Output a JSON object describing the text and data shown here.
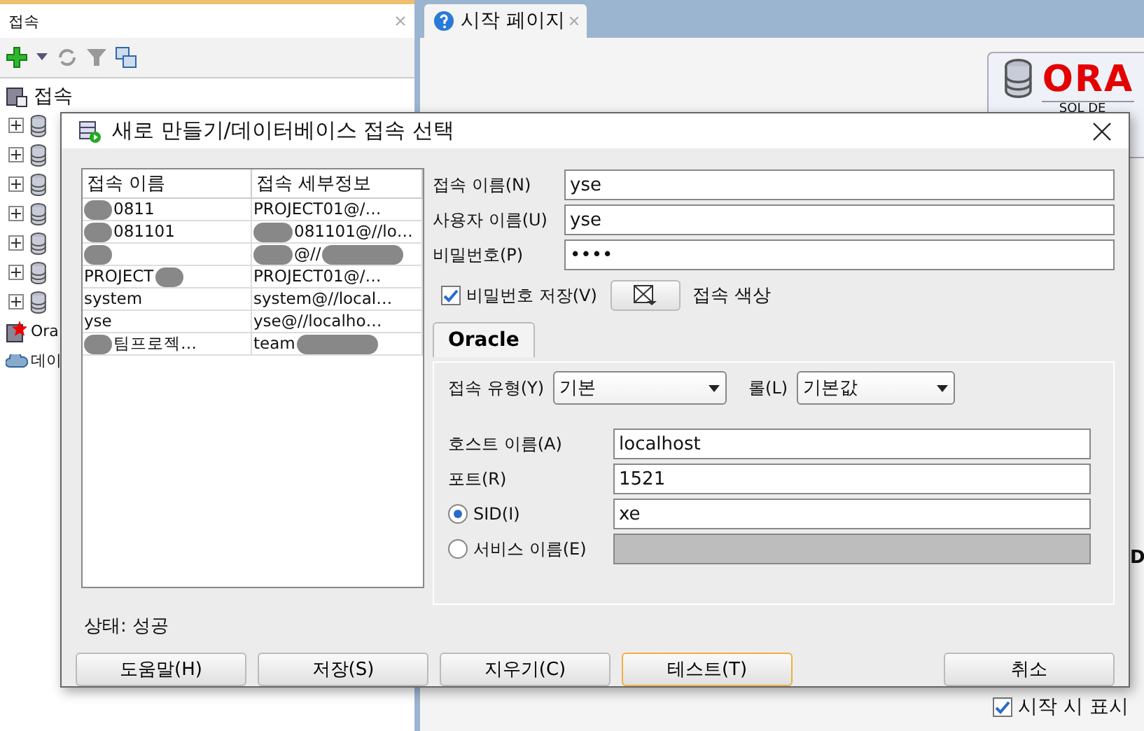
{
  "side_panel": {
    "title": "접속",
    "tree_root": "접속",
    "tree_items": [
      {
        "expanded": false
      },
      {
        "expanded": false
      },
      {
        "expanded": false
      },
      {
        "expanded": false
      },
      {
        "expanded": false
      },
      {
        "expanded": false
      },
      {
        "expanded": false
      }
    ],
    "extra_items": [
      {
        "label": "Ora",
        "kind": "oracle"
      },
      {
        "label": "데이",
        "kind": "cloud"
      }
    ]
  },
  "editor_tab": {
    "label": "시작 페이지"
  },
  "start_page": {
    "logo_text": "ORA",
    "logo_subtitle": "SQL DE",
    "cut_letter": "D",
    "show_on_start": {
      "label": "시작 시 표시",
      "checked": true
    }
  },
  "dialog": {
    "title": "새로 만들기/데이터베이스 접속 선택",
    "columns": [
      "접속 이름",
      "접속 세부정보"
    ],
    "rows": [
      {
        "name": {
          "text": "0811",
          "mask_before": true,
          "mask_after": false
        },
        "details": {
          "text": "PROJECT01@/…",
          "mask_before": false,
          "mask_after": false
        }
      },
      {
        "name": {
          "text": "081101",
          "mask_before": true,
          "mask_after": false
        },
        "details": {
          "text": "081101@//lo…",
          "mask_before": true,
          "mask_after": false
        }
      },
      {
        "name": {
          "mask_before": true,
          "mask_after": false
        },
        "details": {
          "text": "@//",
          "mask_before": true,
          "mask_after": true
        }
      },
      {
        "name": {
          "text": "PROJECT",
          "mask_before": false,
          "mask_after": true
        },
        "details": {
          "text": "PROJECT01@/…",
          "mask_before": false,
          "mask_after": false
        }
      },
      {
        "name": {
          "text": "system",
          "mask_before": false,
          "mask_after": false
        },
        "details": {
          "text": "system@//local…",
          "mask_before": false,
          "mask_after": false
        }
      },
      {
        "name": {
          "text": "yse",
          "mask_before": false,
          "mask_after": false
        },
        "details": {
          "text": "yse@//localho…",
          "mask_before": false,
          "mask_after": false
        }
      },
      {
        "name": {
          "text": "팀프로젝…",
          "mask_before": true,
          "mask_after": false
        },
        "details": {
          "text": "team",
          "mask_before": false,
          "mask_after": true
        }
      }
    ],
    "connection_name": {
      "label": "접속 이름(N)",
      "value": "yse"
    },
    "user_name": {
      "label": "사용자 이름(U)",
      "value": "yse"
    },
    "password": {
      "label": "비밀번호(P)",
      "value": "••••"
    },
    "save_password": {
      "label": "비밀번호 저장(V)",
      "checked": true
    },
    "color_label": "접속 색상",
    "tabs": [
      {
        "label": "Oracle",
        "selected": true
      }
    ],
    "connection_type": {
      "label": "접속 유형(Y)",
      "value": "기본"
    },
    "role": {
      "label": "롤(L)",
      "value": "기본값"
    },
    "host": {
      "label": "호스트 이름(A)",
      "value": "localhost"
    },
    "port": {
      "label": "포트(R)",
      "value": "1521"
    },
    "sid": {
      "label": "SID(I)",
      "value": "xe",
      "selected": true,
      "disabled": false
    },
    "service": {
      "label": "서비스 이름(E)",
      "selected": false,
      "disabled": true
    },
    "status": "상태: 성공",
    "buttons": [
      {
        "label": "도움말(H)",
        "focused": false,
        "kind": "action"
      },
      {
        "label": "저장(S)",
        "focused": false,
        "kind": "action"
      },
      {
        "label": "지우기(C)",
        "focused": false,
        "kind": "action"
      },
      {
        "label": "테스트(T)",
        "focused": true,
        "kind": "action"
      },
      {
        "label": "취소",
        "focused": false,
        "kind": "dismiss"
      }
    ]
  }
}
